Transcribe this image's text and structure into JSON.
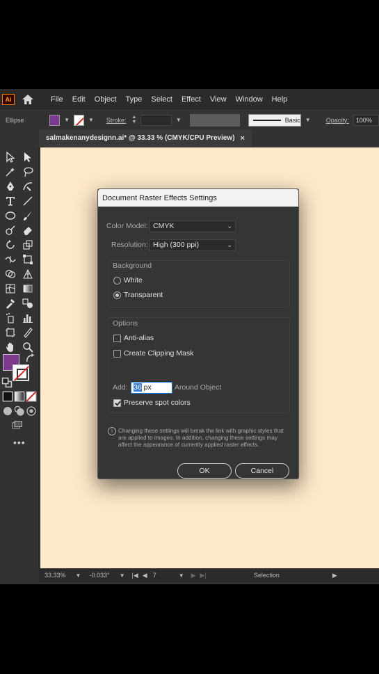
{
  "menubar": {
    "logo": "Ai",
    "items": [
      "File",
      "Edit",
      "Object",
      "Type",
      "Select",
      "Effect",
      "View",
      "Window",
      "Help"
    ]
  },
  "controlbar": {
    "selection_label": "Ellipse",
    "stroke_label": "Stroke:",
    "brush_label": "Basic",
    "opacity_label": "Opacity:",
    "opacity_value": "100%",
    "fill_color": "#7b3a8e"
  },
  "document_tab": {
    "title": "salmakenanydesignn.ai* @ 33.33 % (CMYK/CPU Preview)",
    "close": "×"
  },
  "statusbar": {
    "zoom": "33.33%",
    "rotation": "-0.033°",
    "artboard": "7",
    "tool": "Selection"
  },
  "dialog": {
    "title": "Document Raster Effects Settings",
    "color_model_label": "Color Model:",
    "color_model_value": "CMYK",
    "resolution_label": "Resolution:",
    "resolution_value": "High (300 ppi)",
    "background_label": "Background",
    "white_label": "White",
    "transparent_label": "Transparent",
    "options_label": "Options",
    "anti_alias_label": "Anti-alias",
    "clipping_mask_label": "Create Clipping Mask",
    "add_label": "Add:",
    "add_value_selected": "36",
    "add_value_unit": " px",
    "around_object_label": "Around Object",
    "preserve_spot_label": "Preserve spot colors",
    "info_text": "Changing these settings will break the link with graphic styles that are applied to images. In addition, changing these settings may affect the appearance of currently applied raster effects.",
    "ok_label": "OK",
    "cancel_label": "Cancel"
  },
  "colors": {
    "canvas": "#fde8c8",
    "app_bg": "#323232",
    "accent_purple": "#7b3a8e"
  }
}
